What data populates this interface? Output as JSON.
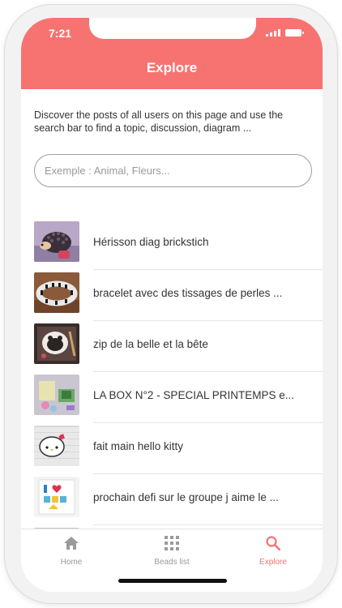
{
  "status_bar": {
    "time": "7:21"
  },
  "header": {
    "title": "Explore"
  },
  "intro_text": "Discover the posts of all users on this page and use the search bar to find a topic, discussion, diagram ...",
  "search": {
    "placeholder": "Exemple : Animal, Fleurs..."
  },
  "posts": [
    {
      "title": "Hérisson diag brickstich"
    },
    {
      "title": "bracelet avec des tissages de perles ..."
    },
    {
      "title": "zip de la belle et la bête"
    },
    {
      "title": "LA BOX N°2 - SPECIAL PRINTEMPS e..."
    },
    {
      "title": "fait main hello kitty"
    },
    {
      "title": "prochain defi sur le groupe j aime le ..."
    }
  ],
  "tab_bar": {
    "home": "Home",
    "beads_list": "Beads list",
    "explore": "Explore"
  },
  "colors": {
    "accent": "#f77371",
    "text": "#333333",
    "muted": "#9a9a9a"
  }
}
